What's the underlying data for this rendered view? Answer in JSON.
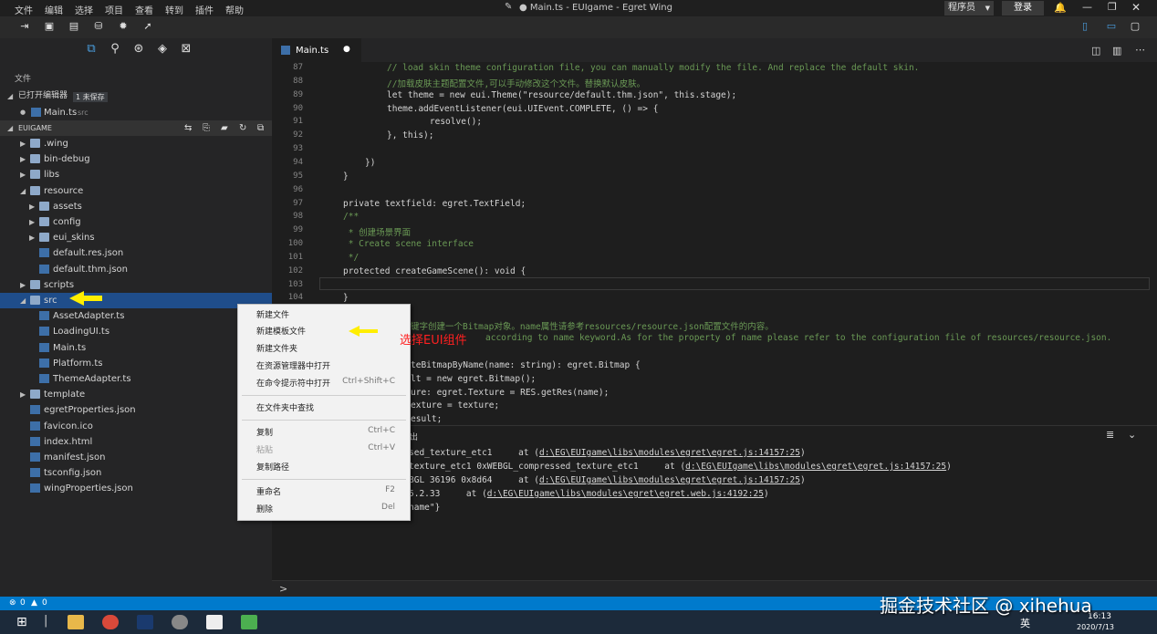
{
  "menu": [
    "文件",
    "编辑",
    "选择",
    "项目",
    "查看",
    "转到",
    "插件",
    "帮助"
  ],
  "window_title": "● Main.ts - EUIgame - Egret Wing",
  "user": "程序员",
  "login": "登录",
  "explorer": {
    "title": "文件",
    "open_editors_label": "已打开编辑器",
    "unsaved_badge": "1 未保存",
    "open_file": "Main.ts",
    "open_file_dir": "src",
    "project_label": "EUIGAME",
    "tree": [
      {
        "label": ".wing",
        "type": "folder"
      },
      {
        "label": "bin-debug",
        "type": "folder"
      },
      {
        "label": "libs",
        "type": "folder"
      },
      {
        "label": "resource",
        "type": "folder"
      },
      {
        "label": "assets",
        "type": "folder"
      },
      {
        "label": "config",
        "type": "folder"
      },
      {
        "label": "eui_skins",
        "type": "folder"
      },
      {
        "label": "default.res.json",
        "type": "file"
      },
      {
        "label": "default.thm.json",
        "type": "file"
      },
      {
        "label": "scripts",
        "type": "folder"
      },
      {
        "label": "src",
        "type": "folder"
      },
      {
        "label": "AssetAdapter.ts",
        "type": "file"
      },
      {
        "label": "LoadingUI.ts",
        "type": "file"
      },
      {
        "label": "Main.ts",
        "type": "file"
      },
      {
        "label": "Platform.ts",
        "type": "file"
      },
      {
        "label": "ThemeAdapter.ts",
        "type": "file"
      },
      {
        "label": "template",
        "type": "folder"
      },
      {
        "label": "egretProperties.json",
        "type": "file"
      },
      {
        "label": "favicon.ico",
        "type": "file"
      },
      {
        "label": "index.html",
        "type": "file"
      },
      {
        "label": "manifest.json",
        "type": "file"
      },
      {
        "label": "tsconfig.json",
        "type": "file"
      },
      {
        "label": "wingProperties.json",
        "type": "file"
      }
    ]
  },
  "tab": {
    "label": "Main.ts"
  },
  "line_numbers": [
    "87",
    "88",
    "89",
    "90",
    "91",
    "92",
    "93",
    "94",
    "95",
    "96",
    "97",
    "98",
    "99",
    "100",
    "101",
    "102",
    "103",
    "104"
  ],
  "code_lines": [
    "// load skin theme configuration file, you can manually modify the file. And replace the default skin.",
    "//加载皮肤主题配置文件,可以手动修改这个文件。替换默认皮肤。",
    "let theme = new eui.Theme(\"resource/default.thm.json\", this.stage);",
    "theme.addEventListener(eui.UIEvent.COMPLETE, () => {",
    "    resolve();",
    "}, this);",
    "",
    "})",
    "}",
    "",
    "private textfield: egret.TextField;",
    "/**",
    " * 创建场景界面",
    " * Create scene interface",
    " */",
    "protected createGameScene(): void {",
    "",
    "}"
  ],
  "code_lower": [
    "键字创建一个Bitmap对象。name属性请参考resources/resource.json配置文件的内容。",
    "according to name keyword.As for the property of name please refer to the configuration file of resources/resource.json.",
    "teBitmapByName(name: string): egret.Bitmap {",
    "lt = new egret.Bitmap();",
    "ure: egret.Texture = RES.getRes(name);",
    "exture = texture;",
    "esult;"
  ],
  "panel_title": "输出",
  "panel_lines": [
    {
      "text": "sed_texture_etc1     at (",
      "link": "d:\\EG\\EUIgame\\libs\\modules\\egret\\egret.js:14157:25",
      "end": ")"
    },
    {
      "text": "texture_etc1 0xWEBGL_compressed_texture_etc1     at (",
      "link": "d:\\EG\\EUIgame\\libs\\modules\\egret\\egret.js:14157:25",
      "end": ")"
    },
    {
      "text": "BGL 36196 0x8d64     at (",
      "link": "d:\\EG\\EUIgame\\libs\\modules\\egret\\egret.js:14157:25",
      "end": ")"
    },
    {
      "text": "5.2.33     at (",
      "link": "d:\\EG\\EUIgame\\libs\\modules\\egret\\egret.web.js:4192:25",
      "end": ")"
    },
    {
      "text": "name\"}",
      "link": "",
      "end": ""
    }
  ],
  "input_prompt": ">",
  "status": {
    "errors": "0",
    "warnings": "0"
  },
  "context_menu": [
    {
      "label": "新建文件",
      "shortcut": "",
      "disabled": false
    },
    {
      "label": "新建模板文件",
      "shortcut": "",
      "disabled": false
    },
    {
      "label": "新建文件夹",
      "shortcut": "",
      "disabled": false
    },
    {
      "label": "在资源管理器中打开",
      "shortcut": "",
      "disabled": false
    },
    {
      "label": "在命令提示符中打开",
      "shortcut": "Ctrl+Shift+C",
      "disabled": false
    },
    {
      "label": "在文件夹中查找",
      "shortcut": "",
      "disabled": false
    },
    {
      "label": "复制",
      "shortcut": "Ctrl+C",
      "disabled": false
    },
    {
      "label": "粘贴",
      "shortcut": "Ctrl+V",
      "disabled": true
    },
    {
      "label": "复制路径",
      "shortcut": "",
      "disabled": false
    },
    {
      "label": "重命名",
      "shortcut": "F2",
      "disabled": false
    },
    {
      "label": "删除",
      "shortcut": "Del",
      "disabled": false
    }
  ],
  "annotation": "选择EUI组件",
  "watermark": "掘金技术社区 @ xihehua",
  "taskbar": {
    "time": "16:13",
    "date": "2020/7/13",
    "ime": "英"
  },
  "colors": {
    "accent": "#007acc",
    "selection": "#1f4d8a",
    "arrow": "#ffee00"
  }
}
